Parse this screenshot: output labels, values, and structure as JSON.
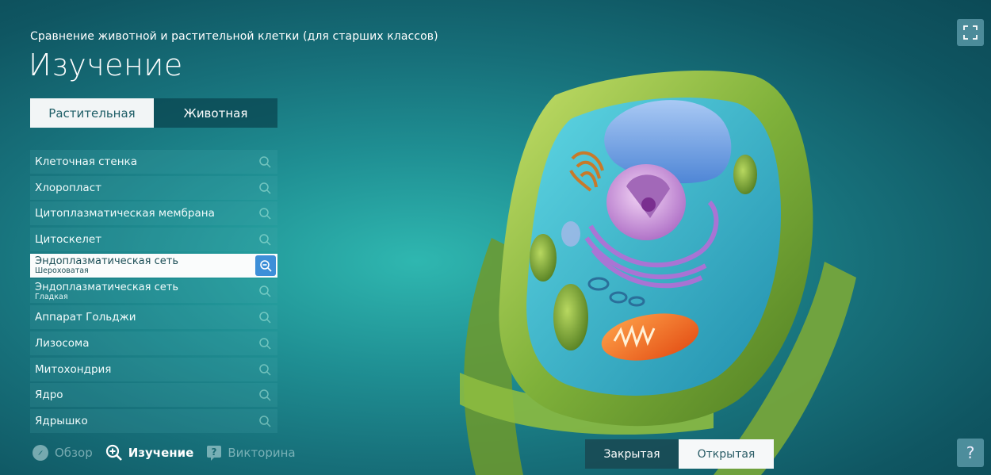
{
  "header": {
    "subtitle": "Сравнение животной и растительной клетки (для старших классов)",
    "title": "Изучение"
  },
  "tabs": [
    {
      "label": "Растительная",
      "active": true
    },
    {
      "label": "Животная",
      "active": false
    }
  ],
  "organelles": [
    {
      "label": "Клеточная стенка",
      "sub": ""
    },
    {
      "label": "Хлоропласт",
      "sub": ""
    },
    {
      "label": "Цитоплазматическая мембрана",
      "sub": ""
    },
    {
      "label": "Цитоскелет",
      "sub": ""
    },
    {
      "label": "Эндоплазматическая сеть",
      "sub": "Шероховатая",
      "selected": true
    },
    {
      "label": "Эндоплазматическая сеть",
      "sub": "Гладкая"
    },
    {
      "label": "Аппарат Гольджи",
      "sub": ""
    },
    {
      "label": "Лизосома",
      "sub": ""
    },
    {
      "label": "Митохондрия",
      "sub": ""
    },
    {
      "label": "Ядро",
      "sub": ""
    },
    {
      "label": "Ядрышко",
      "sub": ""
    }
  ],
  "bottom_nav": {
    "overview": "Обзор",
    "study": "Изучение",
    "quiz": "Викторина"
  },
  "cell_view": {
    "closed": "Закрытая",
    "open": "Открытая"
  },
  "help": {
    "label": "?"
  },
  "icons": {
    "search": "search-icon",
    "fullscreen": "fullscreen-icon",
    "compass": "compass-icon",
    "zoom": "zoom-icon",
    "quiz": "quiz-icon"
  },
  "colors": {
    "accent": "#3d8fd8",
    "tab_active_bg": "#f2f5f6",
    "tab_inactive_bg": "#0e4a55"
  }
}
